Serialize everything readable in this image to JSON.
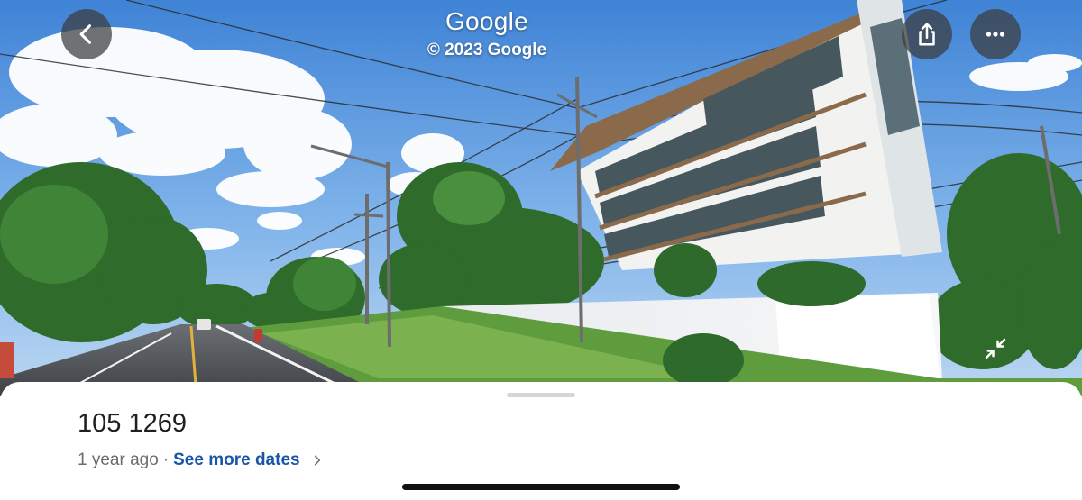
{
  "header": {
    "brand": "Google",
    "copyright": "© 2023 Google"
  },
  "icons": {
    "back": "chevron-left-icon",
    "share": "share-icon",
    "more": "more-horizontal-icon",
    "collapse": "collapse-arrows-icon",
    "dates_chevron": "chevron-right-icon"
  },
  "sheet": {
    "title": "105 1269",
    "age": "1 year ago",
    "separator": "·",
    "see_more_dates": "See more dates"
  },
  "colors": {
    "link": "#1a56a8",
    "button_bg": "#3c3c3c",
    "sky": "#4f8fdc"
  }
}
